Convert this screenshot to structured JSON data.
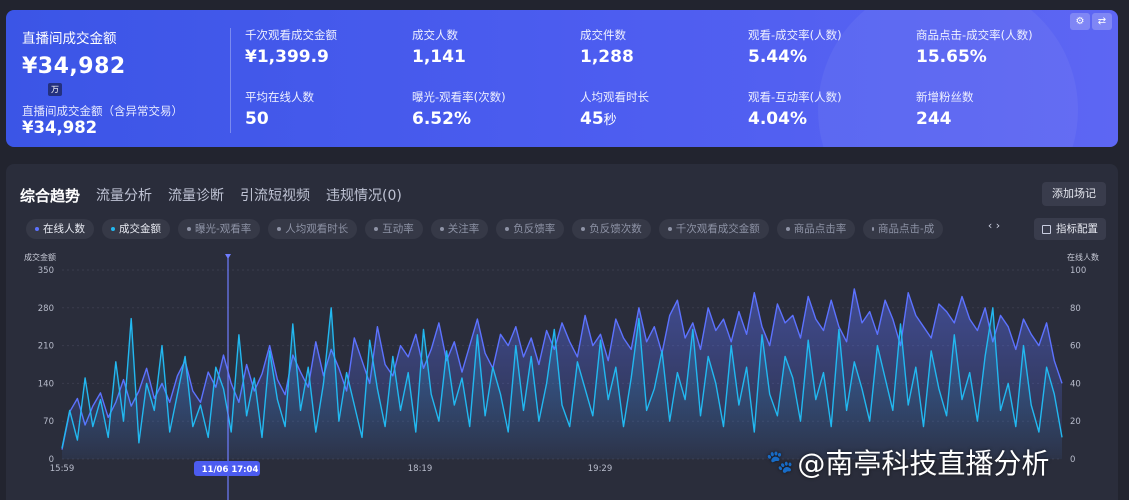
{
  "summary": {
    "main_label": "直播间成交金额",
    "main_value": "¥34,982",
    "unit_badge": "万",
    "sub_label": "直播间成交金额（含异常交易）",
    "sub_value": "¥34,982"
  },
  "metrics": [
    {
      "label": "千次观看成交金额",
      "value": "¥1,399.9"
    },
    {
      "label": "成交人数",
      "value": "1,141"
    },
    {
      "label": "成交件数",
      "value": "1,288"
    },
    {
      "label": "观看-成交率(人数)",
      "value": "5.44%"
    },
    {
      "label": "商品点击-成交率(人数)",
      "value": "15.65%"
    },
    {
      "label": "平均在线人数",
      "value": "50"
    },
    {
      "label": "曝光-观看率(次数)",
      "value": "6.52%"
    },
    {
      "label": "人均观看时长",
      "value": "45",
      "unit": "秒"
    },
    {
      "label": "观看-互动率(人数)",
      "value": "4.04%"
    },
    {
      "label": "新增粉丝数",
      "value": "244"
    }
  ],
  "card_tools": {
    "settings_icon": "gear-icon",
    "swap_icon": "swap-icon"
  },
  "tabs": [
    {
      "label": "综合趋势",
      "active": true
    },
    {
      "label": "流量分析",
      "active": false
    },
    {
      "label": "流量诊断",
      "active": false
    },
    {
      "label": "引流短视频",
      "active": false
    },
    {
      "label": "违规情况(0)",
      "active": false
    }
  ],
  "add_scene_button": "添加场记",
  "metric_chips": [
    {
      "label": "在线人数",
      "active": true,
      "color": "#5c72ff"
    },
    {
      "label": "成交金额",
      "active": true,
      "color": "#22b8f0"
    },
    {
      "label": "曝光-观看率",
      "active": false
    },
    {
      "label": "人均观看时长",
      "active": false
    },
    {
      "label": "互动率",
      "active": false
    },
    {
      "label": "关注率",
      "active": false
    },
    {
      "label": "负反馈率",
      "active": false
    },
    {
      "label": "负反馈次数",
      "active": false
    },
    {
      "label": "千次观看成交金额",
      "active": false
    },
    {
      "label": "商品点击率",
      "active": false
    },
    {
      "label": "商品点击-成",
      "active": false
    }
  ],
  "chip_nav": "‹ ›",
  "config_button": "指标配置",
  "colors": {
    "online_line": "#5c72ff",
    "gmv_line": "#22b8f0",
    "cursor": "#6f7dff",
    "card_start": "#3b55e6",
    "card_end": "#5d66f3"
  },
  "chart_data": {
    "type": "line",
    "left_axis_title": "成交金额",
    "right_axis_title": "在线人数",
    "left_ticks": [
      0,
      70,
      140,
      210,
      280,
      350
    ],
    "right_ticks": [
      0,
      20,
      40,
      60,
      80,
      100
    ],
    "x_tick_labels": [
      "15:59",
      "18:19",
      "19:29"
    ],
    "cursor_label": "11/06 17:04",
    "ylim_left": [
      0,
      350
    ],
    "ylim_right": [
      0,
      100
    ],
    "series": [
      {
        "name": "在线人数",
        "axis": "right",
        "values": [
          5,
          25,
          32,
          18,
          28,
          35,
          22,
          30,
          42,
          28,
          36,
          48,
          32,
          40,
          30,
          44,
          52,
          36,
          30,
          46,
          38,
          55,
          40,
          30,
          50,
          36,
          45,
          60,
          42,
          34,
          55,
          46,
          38,
          62,
          44,
          58,
          48,
          36,
          64,
          52,
          40,
          70,
          50,
          44,
          60,
          54,
          66,
          48,
          58,
          72,
          52,
          62,
          46,
          60,
          74,
          56,
          48,
          66,
          60,
          70,
          54,
          64,
          50,
          68,
          58,
          72,
          62,
          54,
          76,
          60,
          66,
          52,
          74,
          64,
          58,
          80,
          62,
          70,
          56,
          76,
          84,
          64,
          72,
          58,
          80,
          68,
          74,
          62,
          78,
          66,
          88,
          70,
          60,
          82,
          72,
          76,
          64,
          86,
          74,
          68,
          84,
          70,
          62,
          90,
          72,
          78,
          66,
          84,
          74,
          60,
          88,
          76,
          70,
          64,
          82,
          78,
          72,
          86,
          74,
          68,
          80,
          62,
          76,
          70,
          58,
          74,
          66,
          60,
          72,
          52,
          40
        ]
      },
      {
        "name": "成交金额",
        "axis": "left",
        "values": [
          20,
          90,
          35,
          150,
          60,
          110,
          40,
          180,
          70,
          260,
          30,
          140,
          90,
          210,
          50,
          120,
          190,
          60,
          100,
          40,
          170,
          130,
          50,
          230,
          80,
          150,
          40,
          200,
          110,
          60,
          250,
          90,
          170,
          50,
          140,
          280,
          70,
          160,
          100,
          40,
          220,
          130,
          60,
          190,
          90,
          160,
          50,
          240,
          120,
          70,
          200,
          100,
          150,
          60,
          230,
          80,
          170,
          120,
          50,
          210,
          90,
          190,
          70,
          140,
          240,
          100,
          60,
          180,
          130,
          80,
          220,
          110,
          170,
          60,
          150,
          260,
          90,
          130,
          200,
          70,
          160,
          110,
          240,
          80,
          190,
          140,
          60,
          210,
          100,
          170,
          50,
          230,
          120,
          80,
          190,
          150,
          70,
          220,
          110,
          160,
          60,
          240,
          90,
          180,
          130,
          70,
          210,
          150,
          90,
          250,
          100,
          170,
          60,
          200,
          130,
          80,
          230,
          110,
          160,
          70,
          190,
          280,
          90,
          140,
          60,
          210,
          100,
          50,
          170,
          120,
          40
        ]
      }
    ]
  }
}
